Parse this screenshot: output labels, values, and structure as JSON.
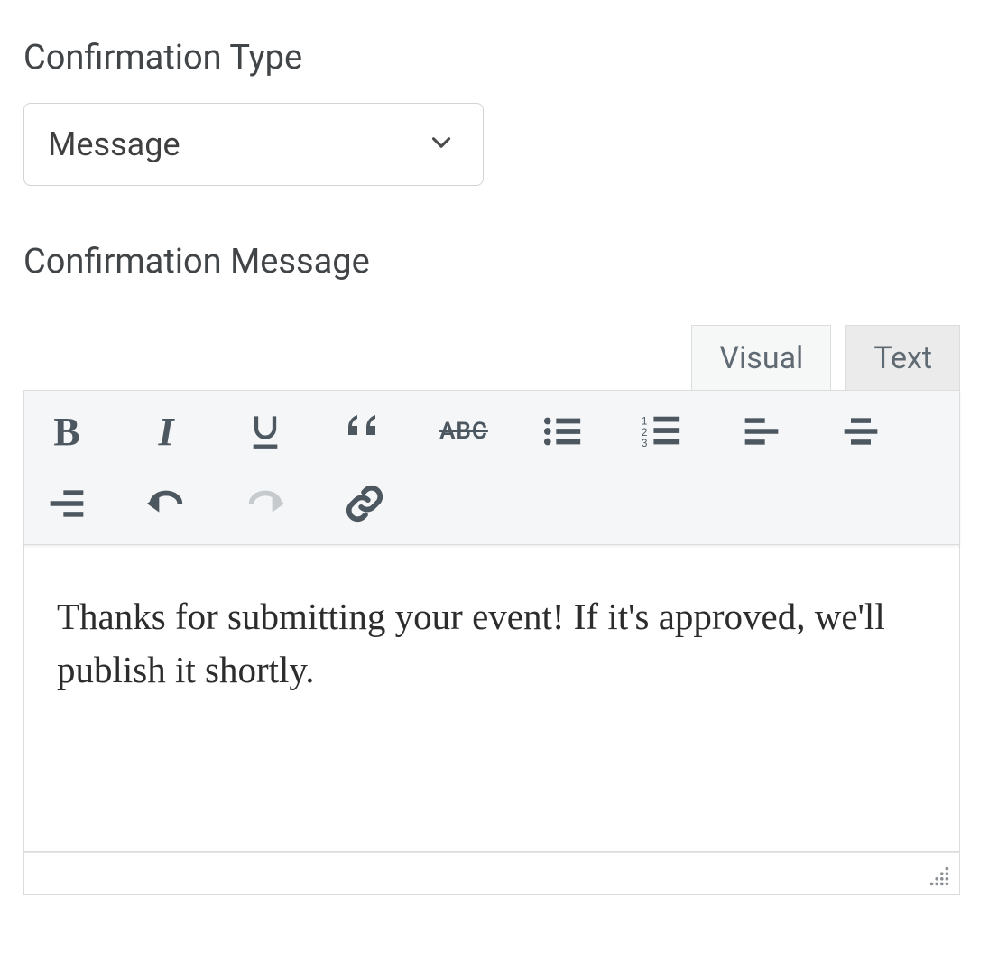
{
  "labels": {
    "confirmation_type": "Confirmation Type",
    "confirmation_message": "Confirmation Message"
  },
  "select": {
    "value": "Message"
  },
  "tabs": {
    "visual": "Visual",
    "text": "Text",
    "active": "visual"
  },
  "toolbar": {
    "buttons": [
      "bold",
      "italic",
      "underline",
      "blockquote",
      "strikethrough",
      "bullet-list",
      "numbered-list",
      "align-left",
      "align-center",
      "align-right",
      "undo",
      "redo",
      "insert-link"
    ]
  },
  "editor": {
    "content": "Thanks for submitting your event! If it's approved, we'll publish it shortly."
  }
}
